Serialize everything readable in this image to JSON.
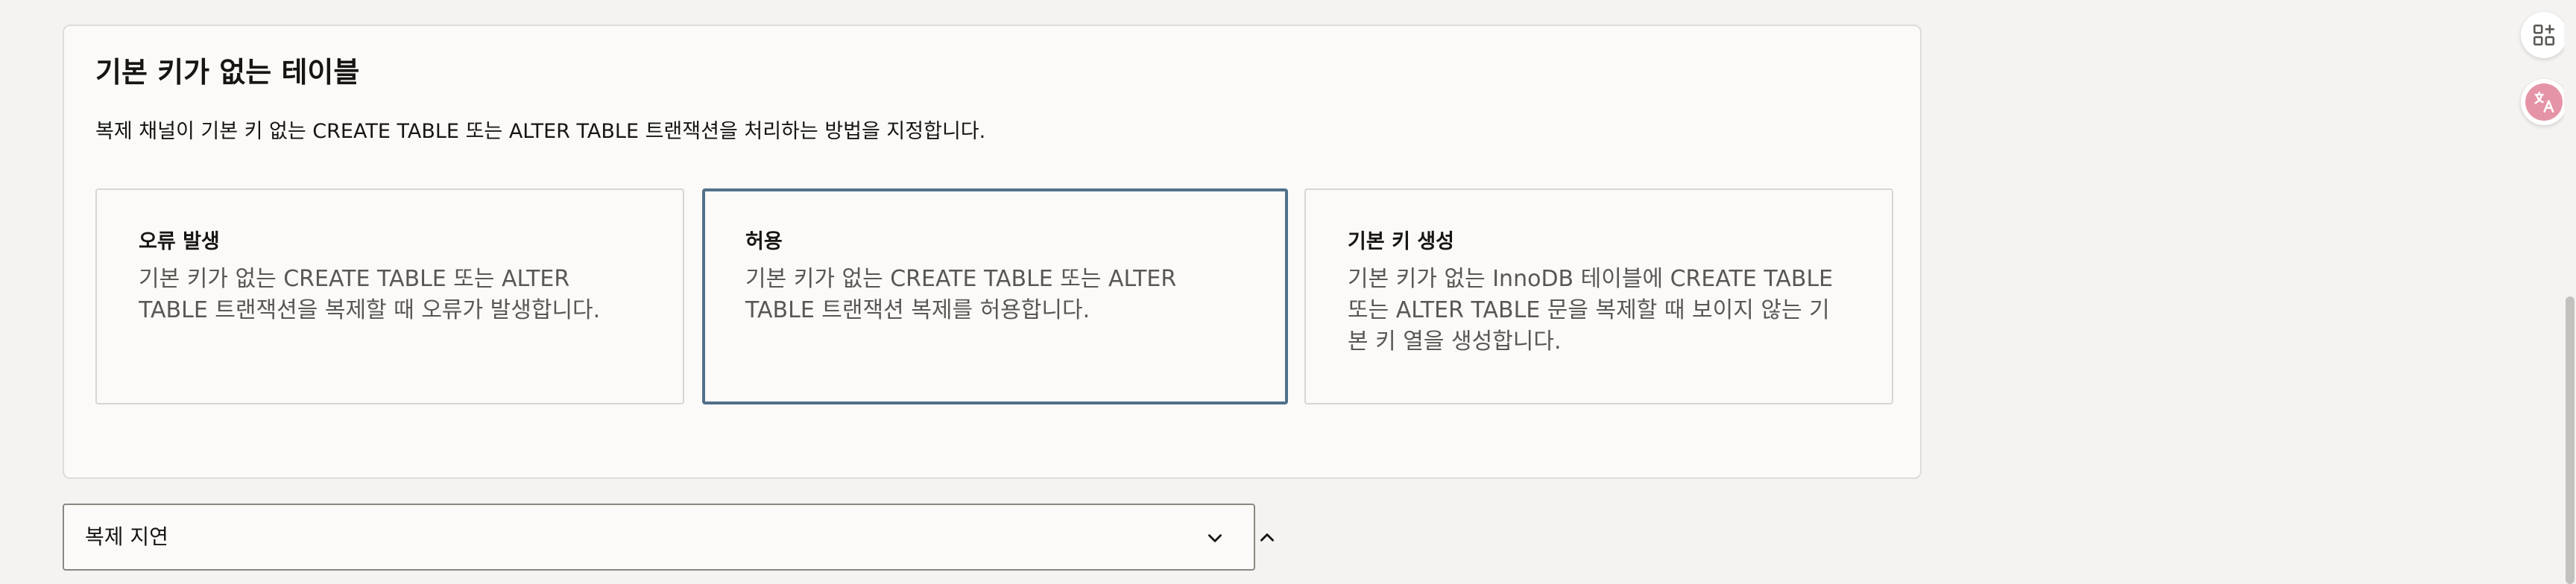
{
  "section": {
    "title": "기본 키가 없는 테이블",
    "description": "복제 채널이 기본 키 없는 CREATE TABLE 또는 ALTER TABLE 트랜잭션을 처리하는 방법을 지정합니다."
  },
  "options": [
    {
      "title": "오류 발생",
      "description": "기본 키가 없는 CREATE TABLE 또는 ALTER TABLE 트랜잭션을 복제할 때 오류가 발생합니다.",
      "selected": false
    },
    {
      "title": "허용",
      "description": "기본 키가 없는 CREATE TABLE 또는 ALTER TABLE 트랜잭션 복제를 허용합니다.",
      "selected": true
    },
    {
      "title": "기본 키 생성",
      "description": "기본 키가 없는 InnoDB 테이블에 CREATE TABLE 또는 ALTER TABLE 문을 복제할 때 보이지 않는 기본 키 열을 생성합니다.",
      "selected": false
    }
  ],
  "accordion": {
    "label": "복제 지연",
    "expand_icon": "chevron-down-icon",
    "collapse_icon": "chevron-up-icon"
  },
  "floating_buttons": {
    "apps_icon": "apps-add-icon",
    "translate_icon": "translate-icon"
  },
  "colors": {
    "selected_border": "#51708b",
    "panel_background": "#fbfaf8",
    "page_background": "#f4f3f1",
    "translate_accent": "#e594a7"
  }
}
